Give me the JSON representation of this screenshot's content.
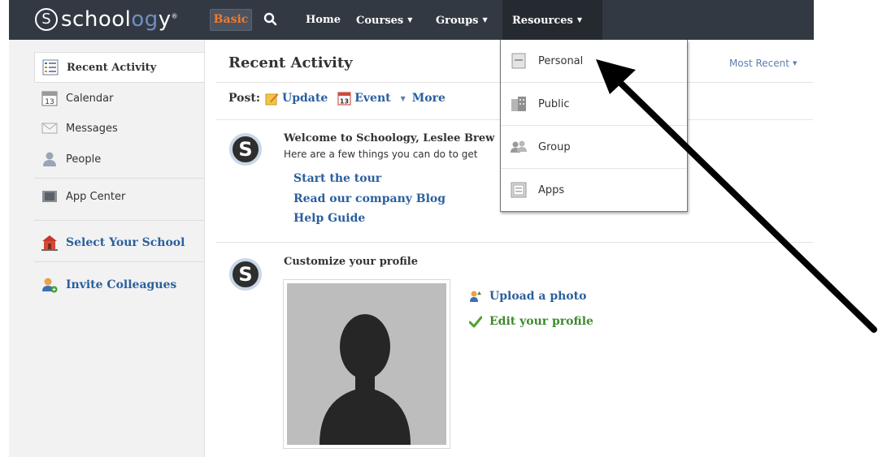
{
  "brand": {
    "logo_letter": "S",
    "logo_pre": "school",
    "logo_oo": "og",
    "logo_post": "y",
    "tm": "®"
  },
  "topnav": {
    "mode_button": "Basic",
    "home": "Home",
    "courses": "Courses",
    "groups": "Groups",
    "resources": "Resources"
  },
  "sidebar": {
    "items": [
      {
        "label": "Recent Activity",
        "icon": "recent-activity-icon"
      },
      {
        "label": "Calendar",
        "icon": "calendar-icon",
        "day": "13"
      },
      {
        "label": "Messages",
        "icon": "envelope-icon"
      },
      {
        "label": "People",
        "icon": "person-icon"
      },
      {
        "label": "App Center",
        "icon": "app-center-icon"
      },
      {
        "label": "Select Your School",
        "icon": "school-icon"
      },
      {
        "label": "Invite Colleagues",
        "icon": "invite-icon"
      }
    ]
  },
  "main": {
    "title": "Recent Activity",
    "sort": "Most Recent",
    "post_label": "Post:",
    "post_update": "Update",
    "post_event": "Event",
    "event_day": "13",
    "post_more": "More",
    "welcome": {
      "avatar_letter": "S",
      "title": "Welcome to Schoology, Leslee Brew",
      "subtitle": "Here are a few things you can do to get",
      "links": [
        "Start the tour",
        "Read our company Blog",
        "Help Guide"
      ]
    },
    "profile": {
      "avatar_letter": "S",
      "title": "Customize your profile",
      "upload": "Upload a photo",
      "edit": "Edit your profile"
    }
  },
  "resources_menu": {
    "items": [
      {
        "label": "Personal",
        "icon": "personal-icon"
      },
      {
        "label": "Public",
        "icon": "public-icon"
      },
      {
        "label": "Group",
        "icon": "group-icon"
      },
      {
        "label": "Apps",
        "icon": "apps-icon"
      }
    ]
  },
  "colors": {
    "topbar": "#333943",
    "accent_orange": "#f47b28",
    "link_blue": "#2a5f9e",
    "green": "#3f8a2f",
    "sidebar_bg": "#f2f2f2"
  }
}
